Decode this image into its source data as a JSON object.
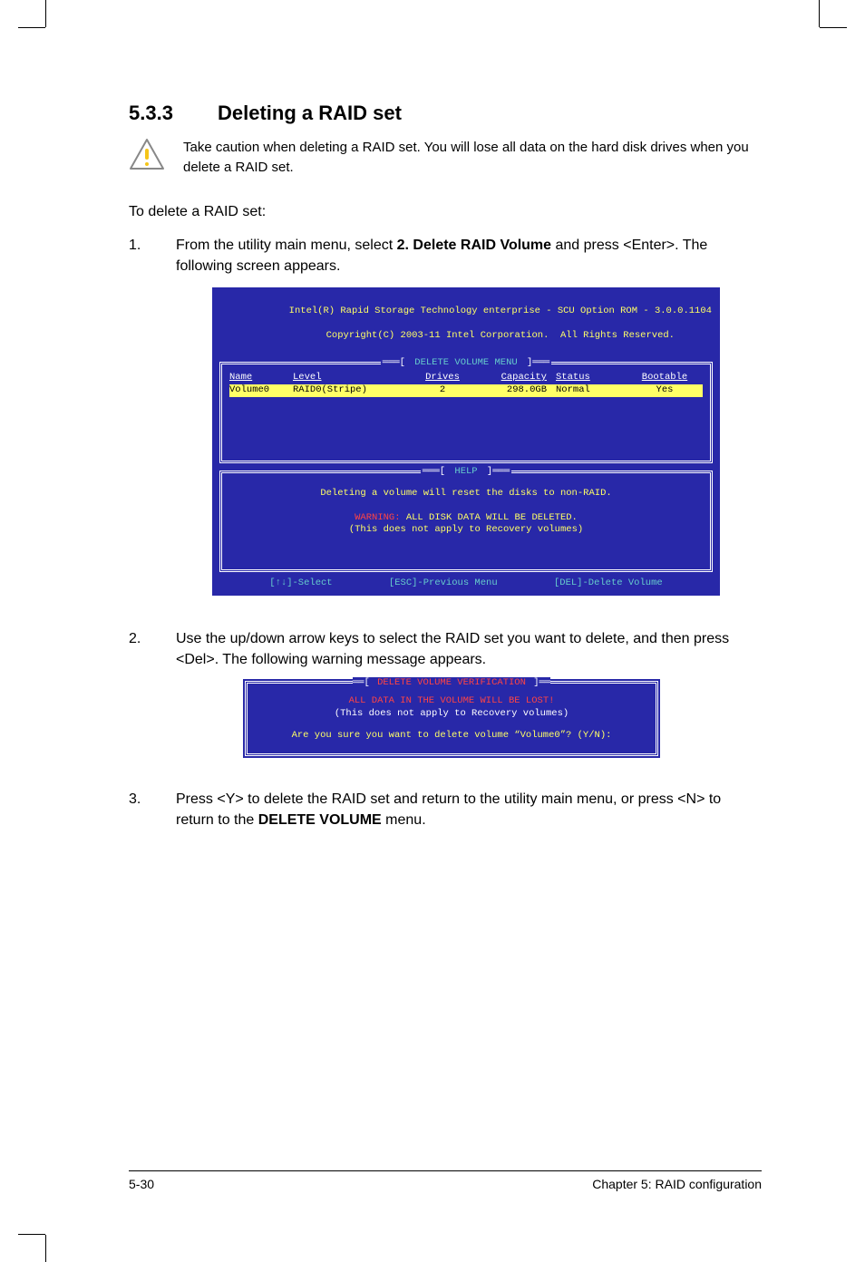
{
  "heading": {
    "number": "5.3.3",
    "title": "Deleting a RAID set"
  },
  "caution": "Take caution when deleting a RAID set. You will lose all data on the hard disk drives when you delete a RAID set.",
  "intro": "To delete a RAID set:",
  "steps": {
    "s1": {
      "num": "1.",
      "pre": "From the utility main menu, select ",
      "bold": "2. Delete RAID Volume",
      "post": " and press <Enter>. The following screen appears."
    },
    "s2": {
      "num": "2.",
      "text": "Use the up/down arrow keys to select the RAID set you want to delete, and then press <Del>. The following warning message appears."
    },
    "s3": {
      "num": "3.",
      "pre": "Press <Y> to delete the RAID set and return to the utility main menu, or press <N> to return to the ",
      "bold": "DELETE VOLUME",
      "post": " menu."
    }
  },
  "bios": {
    "title_l1": "Intel(R) Rapid Storage Technology enterprise - SCU Option ROM - 3.0.0.1104",
    "title_l2": "Copyright(C) 2003-11 Intel Corporation.  All Rights Reserved.",
    "menu_label": "DELETE VOLUME MENU",
    "headers": {
      "name": "Name",
      "level": "Level",
      "drives": "Drives",
      "capacity": "Capacity",
      "status": "Status",
      "bootable": "Bootable"
    },
    "row": {
      "name": "Volume0",
      "level": "RAID0(Stripe)",
      "drives": "2",
      "capacity": "298.0GB",
      "status": "Normal",
      "bootable": "Yes"
    },
    "help_label": "HELP",
    "help_l1": "Deleting a volume will reset the disks to non-RAID.",
    "help_warn_label": "WARNING:",
    "help_warn_text": " ALL DISK DATA WILL BE DELETED.",
    "help_l3": "(This does not apply to Recovery volumes)",
    "footer_select": "[↑↓]-Select",
    "footer_prev": "[ESC]-Previous Menu",
    "footer_del": "[DEL]-Delete Volume"
  },
  "verify": {
    "label": "DELETE VOLUME VERIFICATION",
    "l1": "ALL DATA IN THE VOLUME WILL BE LOST!",
    "l2": "(This does not apply to Recovery volumes)",
    "l3": "Are you sure you want to delete volume “Volume0”? (Y/N):"
  },
  "footer": {
    "left": "5-30",
    "right": "Chapter 5: RAID configuration"
  }
}
